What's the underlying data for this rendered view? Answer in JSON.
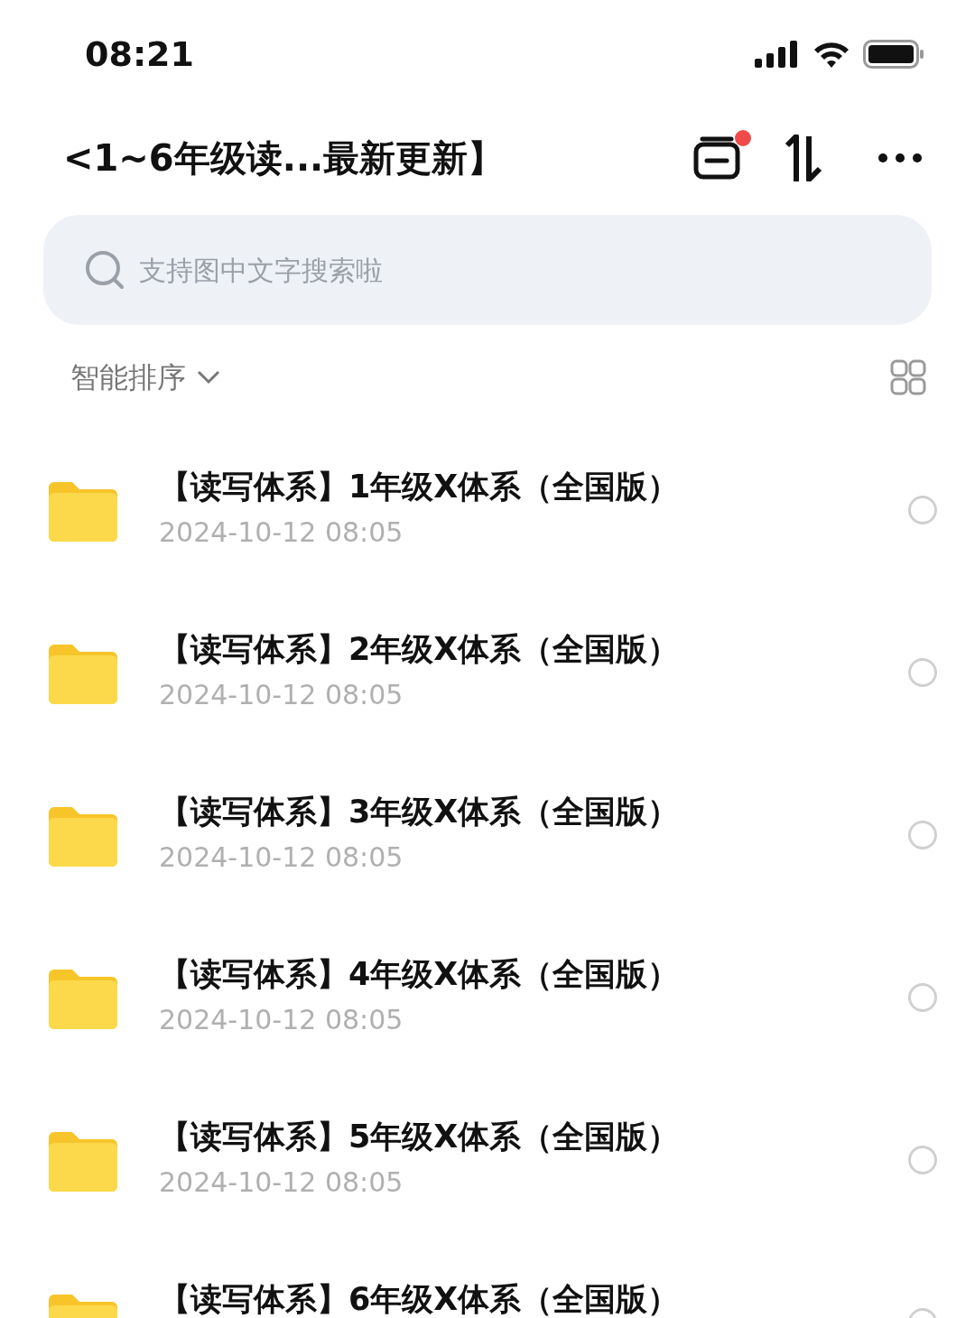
{
  "status_bar": {
    "time": "08:21"
  },
  "header": {
    "back": "<",
    "title": "1~6年级读...最新更新】",
    "badge": true
  },
  "search": {
    "placeholder": "支持图中文字搜索啦"
  },
  "sort": {
    "label": "智能排序"
  },
  "files": [
    {
      "name": "【读写体系】1年级X体系（全国版）",
      "date": "2024-10-12 08:05",
      "selected": false
    },
    {
      "name": "【读写体系】2年级X体系（全国版）",
      "date": "2024-10-12 08:05",
      "selected": false
    },
    {
      "name": "【读写体系】3年级X体系（全国版）",
      "date": "2024-10-12 08:05",
      "selected": false
    },
    {
      "name": "【读写体系】4年级X体系（全国版）",
      "date": "2024-10-12 08:05",
      "selected": false
    },
    {
      "name": "【读写体系】5年级X体系（全国版）",
      "date": "2024-10-12 08:05",
      "selected": false
    },
    {
      "name": "【读写体系】6年级X体系（全国版）",
      "selected": false
    }
  ]
}
